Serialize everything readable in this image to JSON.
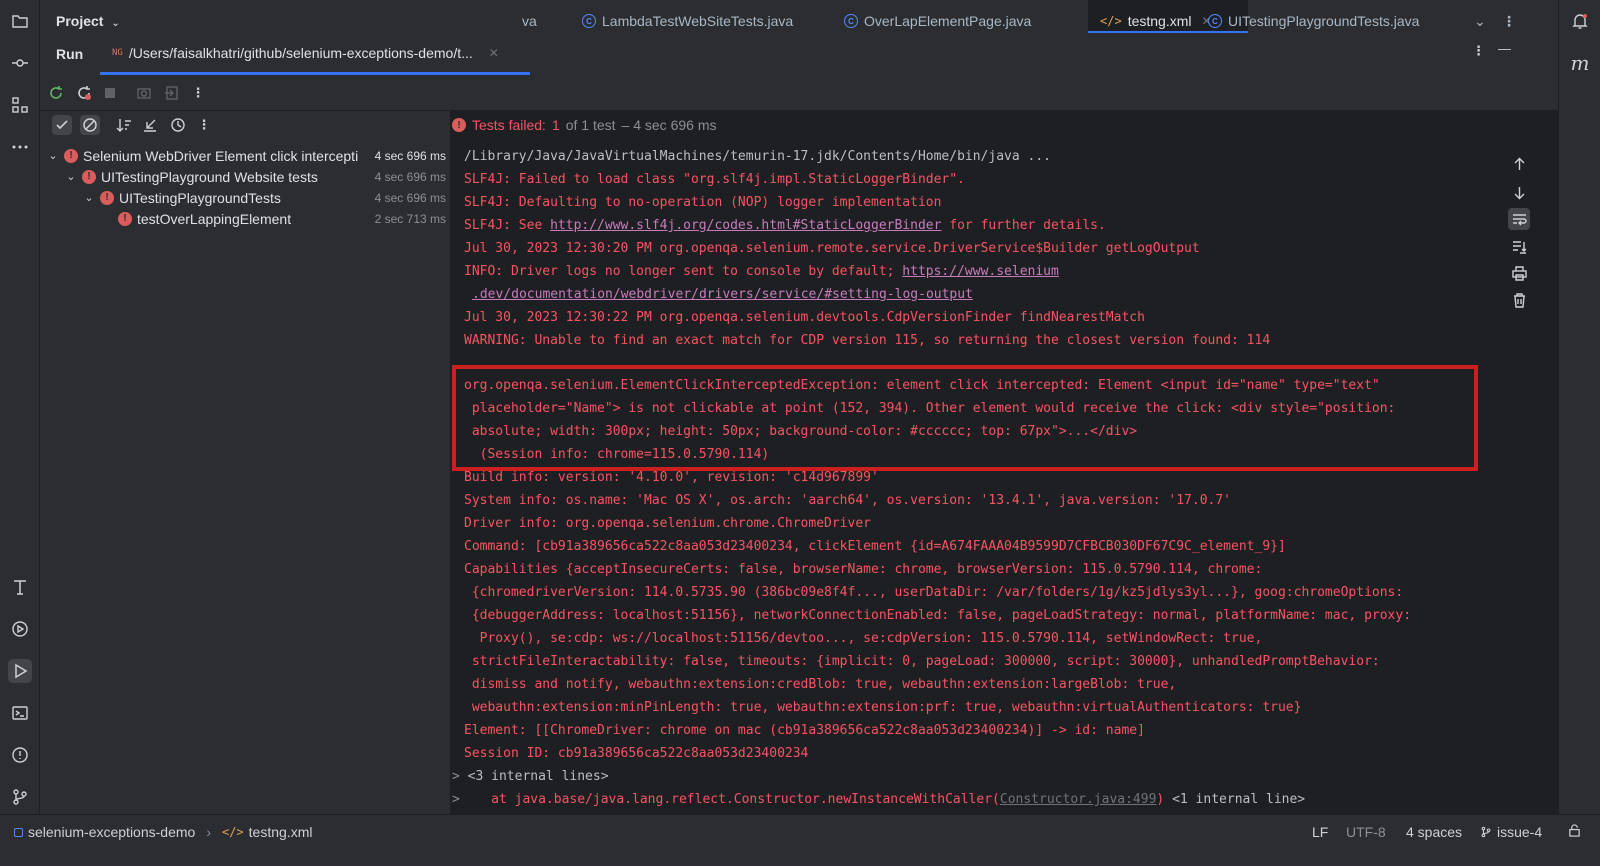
{
  "project": {
    "label": "Project"
  },
  "editor_tabs": [
    {
      "label": "va",
      "icon": "none"
    },
    {
      "label": "LambdaTestWebSiteTests.java",
      "icon": "class-icon"
    },
    {
      "label": "OverLapElementPage.java",
      "icon": "class-icon"
    },
    {
      "label": "testng.xml",
      "icon": "xml-icon",
      "active": true
    },
    {
      "label": "UITestingPlaygroundTests.java",
      "icon": "class-icon"
    }
  ],
  "run": {
    "label": "Run",
    "tab_path": "/Users/faisalkhatri/github/selenium-exceptions-demo/t..."
  },
  "summary": {
    "failed_label": "Tests failed:",
    "failed_count": "1",
    "of_text": "of 1 test",
    "duration": "– 4 sec 696 ms"
  },
  "tree": [
    {
      "label": "Selenium WebDriver Element click intercepti",
      "time": "4 sec 696 ms"
    },
    {
      "label": "UITestingPlayground Website tests",
      "time": "4 sec 696 ms"
    },
    {
      "label": "UITestingPlaygroundTests",
      "time": "4 sec 696 ms"
    },
    {
      "label": "testOverLappingElement",
      "time": "2 sec 713 ms"
    }
  ],
  "console": {
    "java_cmd": "/Library/Java/JavaVirtualMachines/temurin-17.jdk/Contents/Home/bin/java ...",
    "slf1": "SLF4J: Failed to load class \"org.slf4j.impl.StaticLoggerBinder\".",
    "slf2": "SLF4J: Defaulting to no-operation (NOP) logger implementation",
    "slf3_pre": "SLF4J: See ",
    "slf3_link": "http://www.slf4j.org/codes.html#StaticLoggerBinder",
    "slf3_post": " for further details.",
    "log1": "Jul 30, 2023 12:30:20 PM org.openqa.selenium.remote.service.DriverService$Builder getLogOutput",
    "info_pre": "INFO: Driver logs no longer sent to console by default; ",
    "info_link1": "https://www.selenium",
    "info_link2": ".dev/documentation/webdriver/drivers/service/#setting-log-output",
    "log2": "Jul 30, 2023 12:30:22 PM org.openqa.selenium.devtools.CdpVersionFinder findNearestMatch",
    "warning": "WARNING: Unable to find an exact match for CDP version 115, so returning the closest version found: 114",
    "exc1": "org.openqa.selenium.ElementClickInterceptedException: element click intercepted: Element <input id=\"name\" type=\"text\"",
    "exc2": " placeholder=\"Name\"> is not clickable at point (152, 394). Other element would receive the click: <div style=\"position:",
    "exc3": " absolute; width: 300px; height: 50px; background-color: #cccccc; top: 67px\">...</div>",
    "exc4": "  (Session info: chrome=115.0.5790.114)",
    "build": "Build info: version: '4.10.0', revision: 'c14d967899'",
    "system": "System info: os.name: 'Mac OS X', os.arch: 'aarch64', os.version: '13.4.1', java.version: '17.0.7'",
    "driver": "Driver info: org.openqa.selenium.chrome.ChromeDriver",
    "command": "Command: [cb91a389656ca522c8aa053d23400234, clickElement {id=A674FAAA04B9599D7CFBCB030DF67C9C_element_9}]",
    "cap1": "Capabilities {acceptInsecureCerts: false, browserName: chrome, browserVersion: 115.0.5790.114, chrome:",
    "cap2": " {chromedriverVersion: 114.0.5735.90 (386bc09e8f4f..., userDataDir: /var/folders/1g/kz5jdlys3yl...}, goog:chromeOptions:",
    "cap3": " {debuggerAddress: localhost:51156}, networkConnectionEnabled: false, pageLoadStrategy: normal, platformName: mac, proxy:",
    "cap4": "  Proxy(), se:cdp: ws://localhost:51156/devtoo..., se:cdpVersion: 115.0.5790.114, setWindowRect: true,",
    "cap5": " strictFileInteractability: false, timeouts: {implicit: 0, pageLoad: 300000, script: 30000}, unhandledPromptBehavior:",
    "cap6": " dismiss and notify, webauthn:extension:credBlob: true, webauthn:extension:largeBlob: true,",
    "cap7": " webauthn:extension:minPinLength: true, webauthn:extension:prf: true, webauthn:virtualAuthenticators: true}",
    "element": "Element: [[ChromeDriver: chrome on mac (cb91a389656ca522c8aa053d23400234)] -> id: name]",
    "session": "Session ID: cb91a389656ca522c8aa053d23400234",
    "internal": "<3 internal lines>",
    "stack_pre": "    at java.base/java.lang.reflect.Constructor.newInstanceWithCaller(",
    "stack_ref": "Constructor.java:499",
    "stack_post": ")",
    "stack_internal": " <1 internal line>"
  },
  "status": {
    "module": "selenium-exceptions-demo",
    "file": "testng.xml",
    "line_sep": "LF",
    "encoding": "UTF-8",
    "indent": "4 spaces",
    "branch": "issue-4"
  },
  "colors": {
    "error": "#f75464",
    "accent": "#3574f0",
    "highlight_box": "#cc1f1f"
  }
}
